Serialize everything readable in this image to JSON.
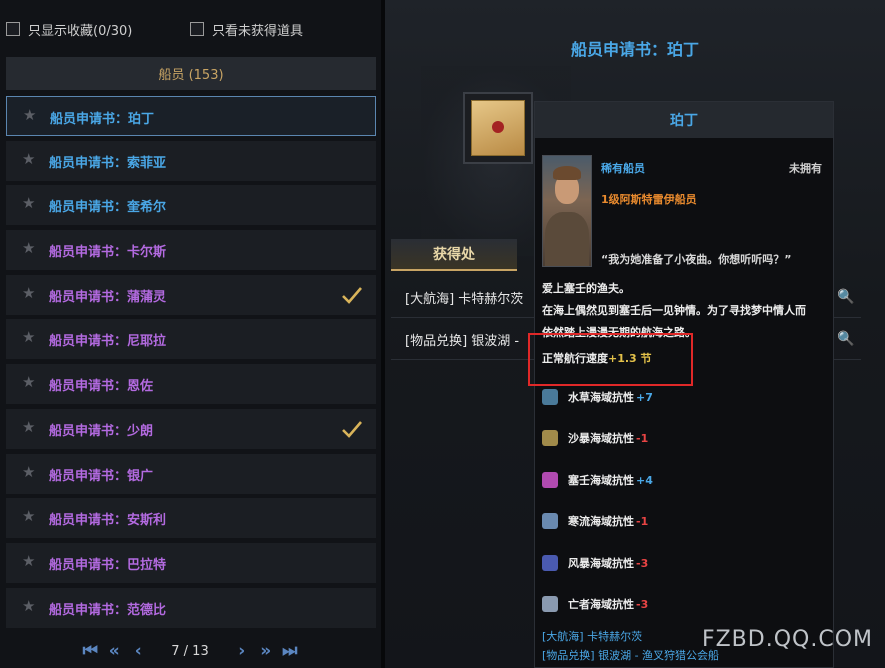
{
  "filters": {
    "favorites_label": "只显示收藏(0/30)",
    "unobtained_label": "只看未获得道具"
  },
  "category": {
    "label": "船员 (153)"
  },
  "colors": {
    "rare": "#4aa7e6",
    "hero": "#b36ae0",
    "level": "#e88a2e",
    "speed": "#e3c14a",
    "negative": "#e84444",
    "check": "#d9b45a",
    "highlight_box": "#e02828"
  },
  "crew_list": [
    {
      "name": "船员申请书：珀丁",
      "rarity": "rare",
      "selected": true,
      "checked": false
    },
    {
      "name": "船员申请书：索菲亚",
      "rarity": "rare",
      "selected": false,
      "checked": false
    },
    {
      "name": "船员申请书：奎希尔",
      "rarity": "rare",
      "selected": false,
      "checked": false
    },
    {
      "name": "船员申请书：卡尔斯",
      "rarity": "hero",
      "selected": false,
      "checked": false
    },
    {
      "name": "船员申请书：蒲蒲灵",
      "rarity": "hero",
      "selected": false,
      "checked": true
    },
    {
      "name": "船员申请书：尼耶拉",
      "rarity": "hero",
      "selected": false,
      "checked": false
    },
    {
      "name": "船员申请书：恩佐",
      "rarity": "hero",
      "selected": false,
      "checked": false
    },
    {
      "name": "船员申请书：少朗",
      "rarity": "hero",
      "selected": false,
      "checked": true
    },
    {
      "name": "船员申请书：银广",
      "rarity": "hero",
      "selected": false,
      "checked": false
    },
    {
      "name": "船员申请书：安斯利",
      "rarity": "hero",
      "selected": false,
      "checked": false
    },
    {
      "name": "船员申请书：巴拉特",
      "rarity": "hero",
      "selected": false,
      "checked": false
    },
    {
      "name": "船员申请书：范德比",
      "rarity": "hero",
      "selected": false,
      "checked": false
    }
  ],
  "pager": {
    "label": "7 / 13"
  },
  "detail": {
    "title": "船员申请书：珀丁",
    "source_tab": "获得处",
    "sources": [
      "[大航海] 卡特赫尔茨",
      "[物品兑换] 银波湖 -"
    ]
  },
  "tooltip": {
    "name": "珀丁",
    "rarity": "稀有船员",
    "owned": "未拥有",
    "level": "1级阿斯特雷伊船员",
    "quote": "“我为她准备了小夜曲。你想听听吗？”",
    "desc_lines": [
      "爱上塞壬的渔夫。",
      "在海上偶然见到塞壬后一见钟情。为了寻找梦中情人而",
      "依然踏上漫漫无期的航海之路。"
    ],
    "speed_label": "正常航行速度",
    "speed_value": "+1.3 节",
    "resistances": [
      {
        "label": "水草海域抗性",
        "value": "+7",
        "sign": "pos",
        "icon": "seaweed-icon",
        "color": "#4a7a9a"
      },
      {
        "label": "沙暴海域抗性",
        "value": "-1",
        "sign": "neg",
        "icon": "sandstorm-icon",
        "color": "#a08a4a"
      },
      {
        "label": "塞壬海域抗性",
        "value": "+4",
        "sign": "pos",
        "icon": "siren-icon",
        "color": "#b04ab0"
      },
      {
        "label": "寒流海域抗性",
        "value": "-1",
        "sign": "neg",
        "icon": "cold-current-icon",
        "color": "#6a8ab0"
      },
      {
        "label": "风暴海域抗性",
        "value": "-3",
        "sign": "neg",
        "icon": "storm-icon",
        "color": "#4a5ab0"
      },
      {
        "label": "亡者海域抗性",
        "value": "-3",
        "sign": "neg",
        "icon": "undead-icon",
        "color": "#8a9ab0"
      }
    ],
    "sources": [
      "[大航海] 卡特赫尔茨",
      "[物品兑换] 银波湖 - 渔叉狩猎公会船"
    ]
  },
  "watermark": "FZBD.QQ.COM"
}
